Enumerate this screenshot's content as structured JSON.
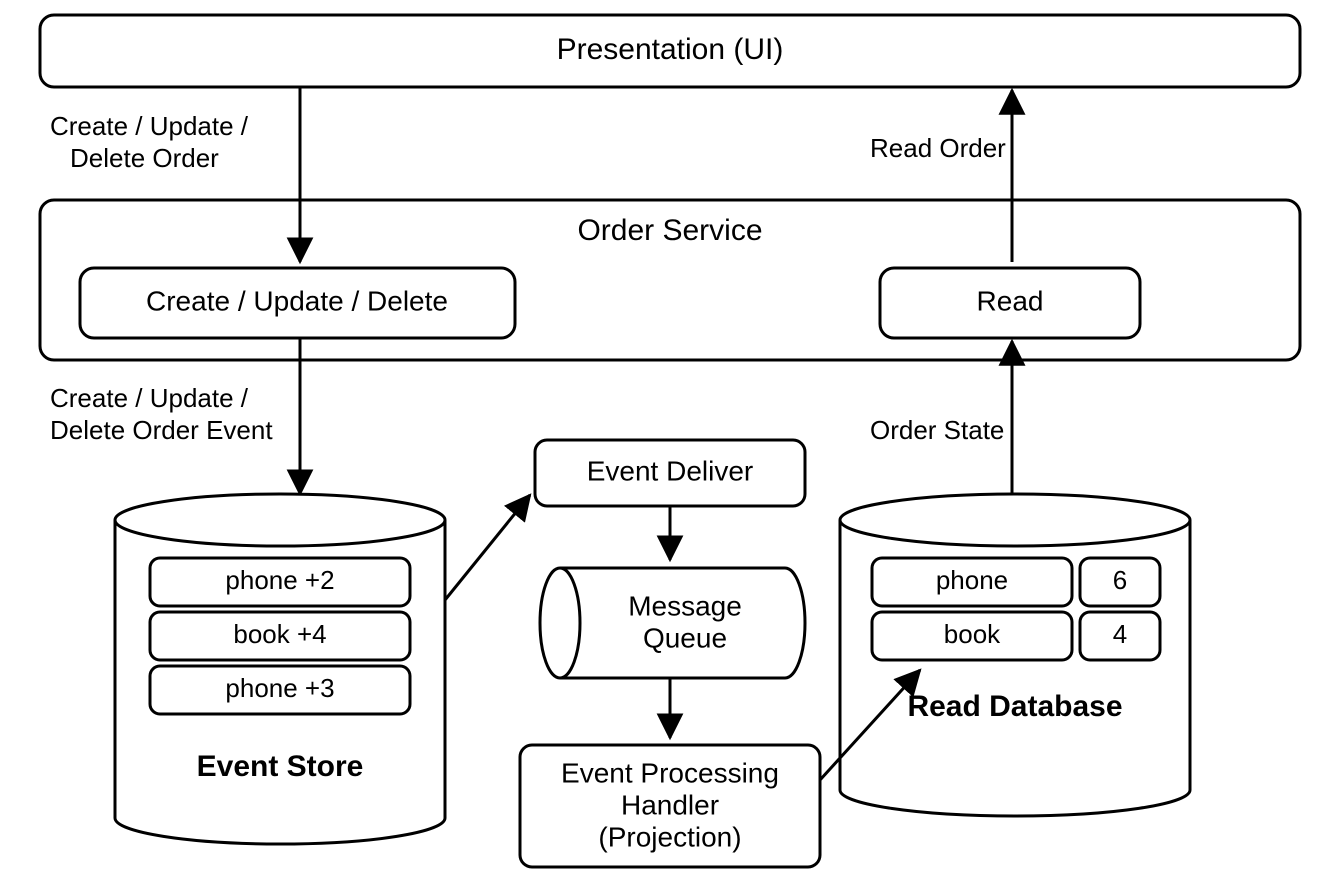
{
  "nodes": {
    "presentation": "Presentation (UI)",
    "order_service": "Order Service",
    "cud_box": "Create / Update / Delete",
    "read_box": "Read",
    "event_deliver": "Event Deliver",
    "message_queue_l1": "Message",
    "message_queue_l2": "Queue",
    "eph_l1": "Event Processing",
    "eph_l2": "Handler",
    "eph_l3": "(Projection)"
  },
  "stores": {
    "event_store_title": "Event Store",
    "read_db_title": "Read Database",
    "event_store_rows": [
      "phone +2",
      "book +4",
      "phone +3"
    ],
    "read_db_rows": [
      {
        "key": "phone",
        "val": "6"
      },
      {
        "key": "book",
        "val": "4"
      }
    ]
  },
  "edges": {
    "ui_to_cud_l1": "Create / Update /",
    "ui_to_cud_l2": "Delete Order",
    "read_to_ui": "Read Order",
    "cud_to_store_l1": "Create / Update /",
    "cud_to_store_l2": "Delete Order Event",
    "readdb_to_read": "Order State"
  }
}
